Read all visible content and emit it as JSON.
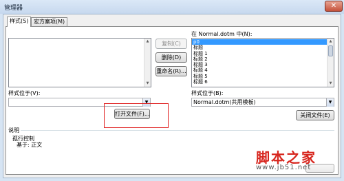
{
  "window": {
    "title": "管理器",
    "close_glyph": "✕"
  },
  "tabs": [
    {
      "label": "样式(S)"
    },
    {
      "label": "宏方案项(M)"
    }
  ],
  "left": {
    "source_label": "样式位于(V):",
    "source_value": "",
    "open_file_button": "打开文件(F)..."
  },
  "middle_buttons": {
    "copy": "复制(C)",
    "delete": "删除(D)",
    "rename": "重命名(R)..."
  },
  "right": {
    "list_label": "在 Normal.dotm 中(N):",
    "items": [
      "p0",
      "标题",
      "标题 1",
      "标题 2",
      "标题 3",
      "标题 4",
      "标题 5",
      "标题 6"
    ],
    "selected_index": 0,
    "source_label": "样式位于(B):",
    "source_value": "Normal.dotm(共用模板)",
    "close_file_button": "关闭文件(E)"
  },
  "description": {
    "label": "说明",
    "line1": "孤行控制",
    "line2": "基于: 正文"
  },
  "watermark": {
    "main": "脚本之家",
    "url": "www.jb51.net"
  }
}
